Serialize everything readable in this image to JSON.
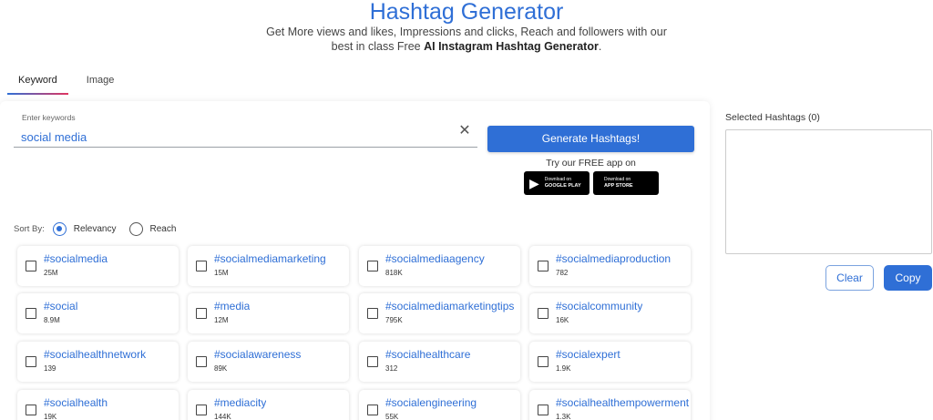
{
  "header": {
    "title": "Hashtag Generator",
    "subtitle_line1": "Get More views and likes, Impressions and clicks, Reach and followers with our",
    "subtitle_line2_prefix": "best in class Free ",
    "subtitle_line2_bold": "AI Instagram Hashtag Generator",
    "subtitle_line2_suffix": "."
  },
  "tabs": [
    {
      "label": "Keyword",
      "active": true
    },
    {
      "label": "Image",
      "active": false
    }
  ],
  "search": {
    "label": "Enter keywords",
    "value": "social media",
    "clear_icon": "close-icon"
  },
  "actions": {
    "generate_label": "Generate Hashtags!",
    "free_app_text": "Try our FREE app on",
    "google_play": {
      "line1": "Download on",
      "line2": "GOOGLE PLAY"
    },
    "app_store": {
      "line1": "Download on",
      "line2": "APP STORE"
    }
  },
  "sort": {
    "label": "Sort By:",
    "options": [
      {
        "label": "Relevancy",
        "selected": true
      },
      {
        "label": "Reach",
        "selected": false
      }
    ]
  },
  "hashtags": [
    {
      "tag": "#socialmedia",
      "count": "25M"
    },
    {
      "tag": "#socialmediamarketing",
      "count": "15M"
    },
    {
      "tag": "#socialmediaagency",
      "count": "818K"
    },
    {
      "tag": "#socialmediaproduction",
      "count": "782"
    },
    {
      "tag": "#social",
      "count": "8.9M"
    },
    {
      "tag": "#media",
      "count": "12M"
    },
    {
      "tag": "#socialmediamarketingtips",
      "count": "795K"
    },
    {
      "tag": "#socialcommunity",
      "count": "16K"
    },
    {
      "tag": "#socialhealthnetwork",
      "count": "139"
    },
    {
      "tag": "#socialawareness",
      "count": "89K"
    },
    {
      "tag": "#socialhealthcare",
      "count": "312"
    },
    {
      "tag": "#socialexpert",
      "count": "1.9K"
    },
    {
      "tag": "#socialhealth",
      "count": "19K"
    },
    {
      "tag": "#mediacity",
      "count": "144K"
    },
    {
      "tag": "#socialengineering",
      "count": "55K"
    },
    {
      "tag": "#socialhealthempowerment",
      "count": "1.3K"
    }
  ],
  "selected": {
    "title": "Selected Hashtags (0)",
    "clear_label": "Clear",
    "copy_label": "Copy"
  },
  "colors": {
    "accent": "#2f6fd6",
    "tab_gradient_end": "#e0345f"
  }
}
